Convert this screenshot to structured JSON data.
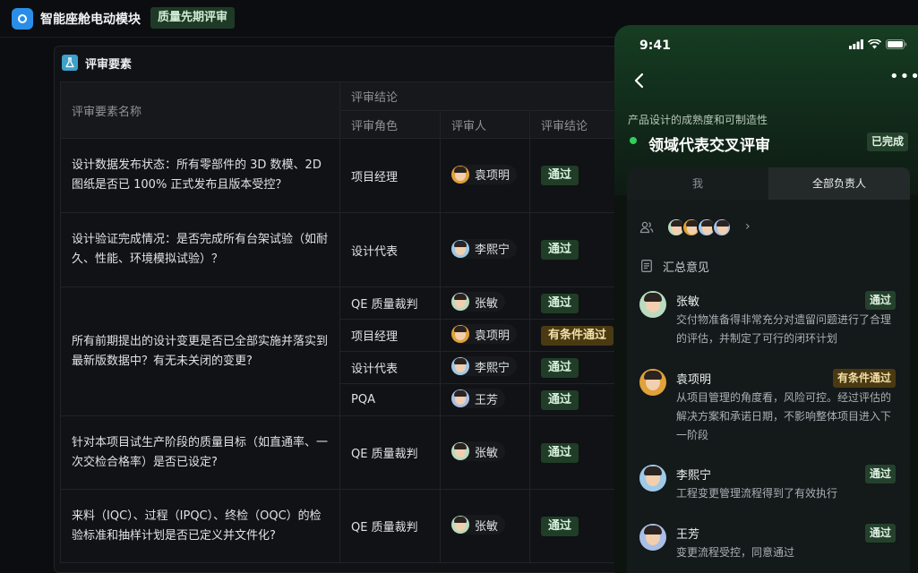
{
  "app": {
    "title": "智能座舱电动模块",
    "phase": "质量先期评审"
  },
  "panel": {
    "title": "评审要素"
  },
  "table": {
    "headers": {
      "item": "评审要素名称",
      "group": "评审结论",
      "role": "评审角色",
      "reviewer": "评审人",
      "result": "评审结论"
    },
    "rows": [
      {
        "item": "设计数据发布状态：所有零部件的 3D 数模、2D 图纸是否已 100% 正式发布且版本受控？",
        "role": "项目经理",
        "reviewer": "袁项明",
        "result": "通过"
      },
      {
        "item": "设计验证完成情况：是否完成所有台架试验（如耐久、性能、环境模拟试验）？",
        "role": "设计代表",
        "reviewer": "李熙宁",
        "result": "通过"
      },
      {
        "item": "所有前期提出的设计变更是否已全部实施并落实到最新版数据中？有无未关闭的变更?",
        "role": "QE 质量裁判",
        "reviewer": "张敏",
        "result": "通过"
      },
      {
        "role": "项目经理",
        "reviewer": "袁项明",
        "result": "有条件通过"
      },
      {
        "role": "设计代表",
        "reviewer": "李熙宁",
        "result": "通过"
      },
      {
        "role": "PQA",
        "reviewer": "王芳",
        "result": "通过"
      },
      {
        "item": "针对本项目试生产阶段的质量目标（如直通率、一次交检合格率）是否已设定?",
        "role": "QE 质量裁判",
        "reviewer": "张敏",
        "result": "通过"
      },
      {
        "item": "来料（IQC）、过程（IPQC）、终检（OQC）的检验标准和抽样计划是否已定义并文件化?",
        "role": "QE 质量裁判",
        "reviewer": "张敏",
        "result": "通过"
      }
    ]
  },
  "phone": {
    "time": "9:41",
    "subtitle": "产品设计的成熟度和可制造性",
    "title": "领域代表交叉评审",
    "status": "已完成",
    "tabs": [
      "我",
      "全部负责人"
    ],
    "summary_label": "汇总意见",
    "opinions": [
      {
        "name": "张敏",
        "result": "通过",
        "text": "交付物准备得非常充分对遗留问题进行了合理的评估，并制定了可行的闭环计划"
      },
      {
        "name": "袁项明",
        "result": "有条件通过",
        "text": "从项目管理的角度看，风险可控。经过评估的解决方案和承诺日期，不影响整体项目进入下一阶段"
      },
      {
        "name": "李熙宁",
        "result": "通过",
        "text": "工程变更管理流程得到了有效执行"
      },
      {
        "name": "王芳",
        "result": "通过",
        "text": "变更流程受控，同意通过"
      }
    ]
  }
}
